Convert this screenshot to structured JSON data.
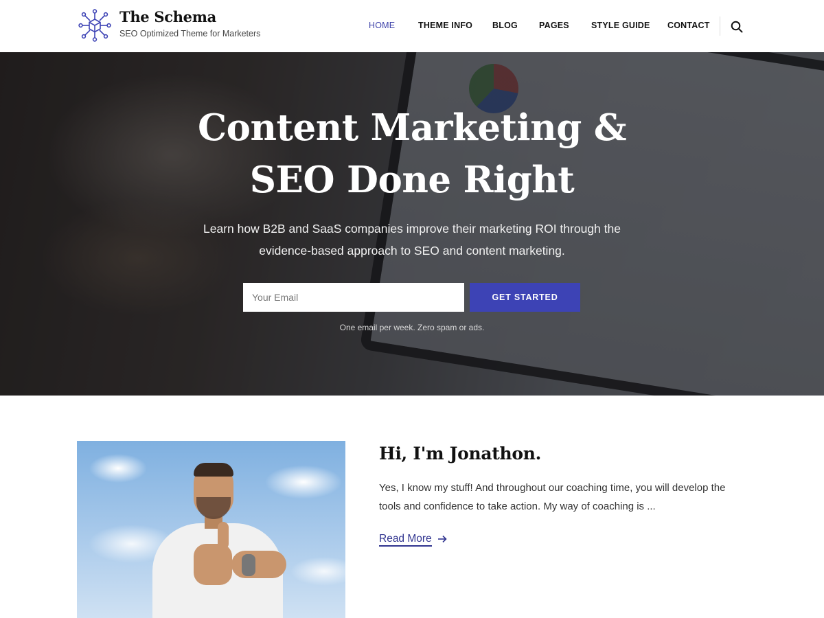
{
  "site": {
    "title": "The Schema",
    "tagline": "SEO Optimized Theme for Marketers"
  },
  "nav": {
    "items": [
      {
        "label": "HOME",
        "active": true
      },
      {
        "label": "THEME INFO",
        "active": false
      },
      {
        "label": "BLOG",
        "active": false
      },
      {
        "label": "PAGES",
        "active": false
      },
      {
        "label": "STYLE GUIDE",
        "active": false
      },
      {
        "label": "CONTACT",
        "active": false
      }
    ],
    "search_icon": "search-icon"
  },
  "hero": {
    "title_line1": "Content Marketing &",
    "title_line2": "SEO Done Right",
    "subtitle_line1": "Learn how B2B and SaaS companies improve their marketing ROI through the",
    "subtitle_line2": "evidence-based approach to SEO and content marketing.",
    "email_placeholder": "Your Email",
    "cta_label": "GET STARTED",
    "note": "One email per week. Zero spam or ads."
  },
  "about": {
    "heading": "Hi, I'm Jonathon.",
    "text": "Yes, I know my stuff! And throughout our coaching time, you will develop the tools and confidence to take action. My way of coaching is ...",
    "read_more": "Read More",
    "read_more_icon": "arrow-right-icon"
  },
  "colors": {
    "accent": "#3d43b5",
    "nav_active": "#3b3fa8",
    "link": "#2f338f",
    "text_dark": "#111111"
  }
}
